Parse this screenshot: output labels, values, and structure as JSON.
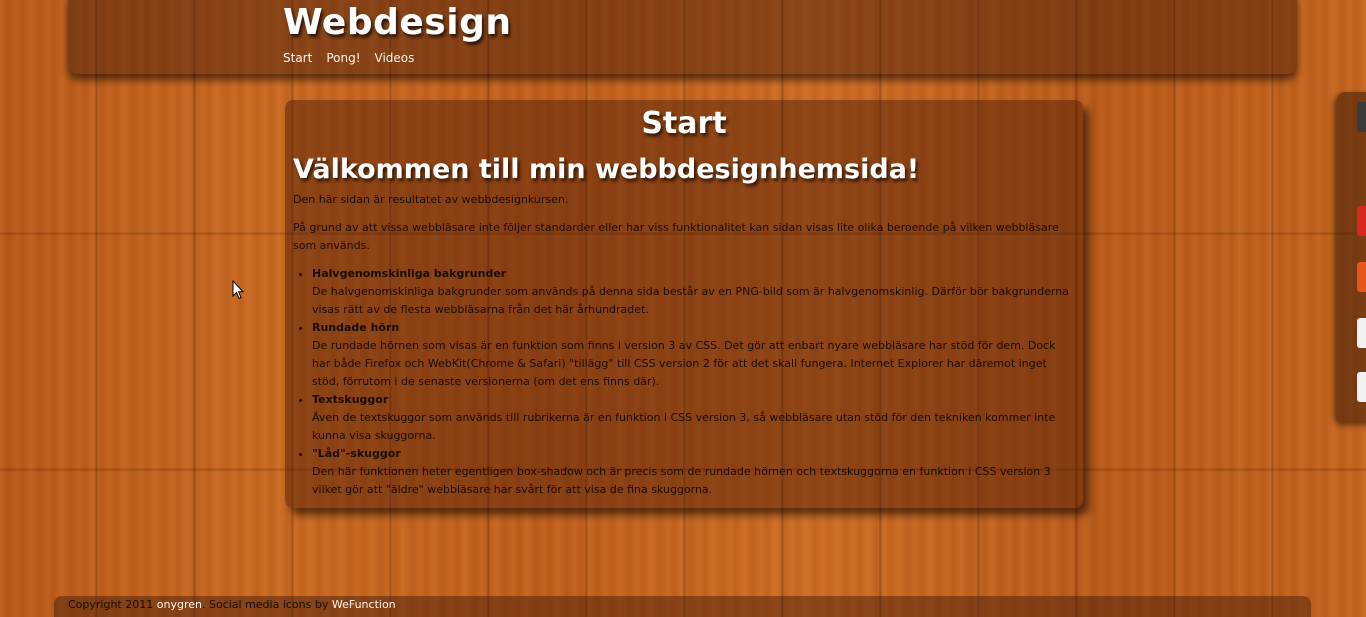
{
  "header": {
    "site_title": "Webdesign",
    "nav": [
      "Start",
      "Pong!",
      "Videos"
    ]
  },
  "main": {
    "page_heading": "Start",
    "welcome_heading": "Välkommen till min webbdesignhemsida!",
    "intro": "Den här sidan är resultatet av webbdesignkursen.",
    "paragraph": "På grund av att vissa webbläsare inte följer standarder eller har viss funktionalitet kan sidan visas lite olika beroende på vilken webbläsare som används.",
    "features": [
      {
        "title": "Halvgenomskinliga bakgrunder",
        "text": "De halvgenomskinliga bakgrunder som används på denna sida består av en PNG-bild som är halvgenomskinlig. Därför bör bakgrunderna visas rätt av de flesta webbläsarna från det här århundradet."
      },
      {
        "title": "Rundade hörn",
        "text": "De rundade hörnen som visas är en funktion som finns i version 3 av CSS. Det gör att enbart nyare webbläsare har stöd för dem. Dock har både Firefox och WebKit(Chrome & Safari) \"tillägg\" till CSS version 2 för att det skall fungera. Internet Explorer har däremot inget stöd, förrutom i de senaste versionerna (om det ens finns där)."
      },
      {
        "title": "Textskuggor",
        "text": "Även de textskuggor som används till rubrikerna är en funktion i CSS version 3, så webbläsare utan stöd för den tekniken kommer inte kunna visa skuggorna."
      },
      {
        "title": "\"Låd\"-skuggor",
        "text": "Den här funktionen heter egentligen box-shadow och är precis som de rundade hörnen och textskuggorna en funktion i CSS version 3 vilket gör att \"äldre\" webbläsare har svårt för att visa de fina skuggorna."
      }
    ]
  },
  "footer": {
    "copyright_prefix": "Copyright 2011 ",
    "author_link": "onygren",
    "icons_text": ". Social media icons by ",
    "icons_link": "WeFunction"
  },
  "side_widget": {
    "icons": [
      {
        "name": "monitor-icon",
        "color": "#3a3a3a"
      },
      {
        "name": "pdf-icon",
        "color": "#d8271f"
      },
      {
        "name": "rss-icon",
        "color": "#e8561a"
      },
      {
        "name": "mail-icon",
        "color": "#f2f2f2"
      },
      {
        "name": "share-icon",
        "color": "#f2f2f2"
      }
    ]
  },
  "colors": {
    "wood": "#c4651f",
    "panel": "#46190580",
    "heading": "#ffffff",
    "text": "#1a0c04"
  }
}
